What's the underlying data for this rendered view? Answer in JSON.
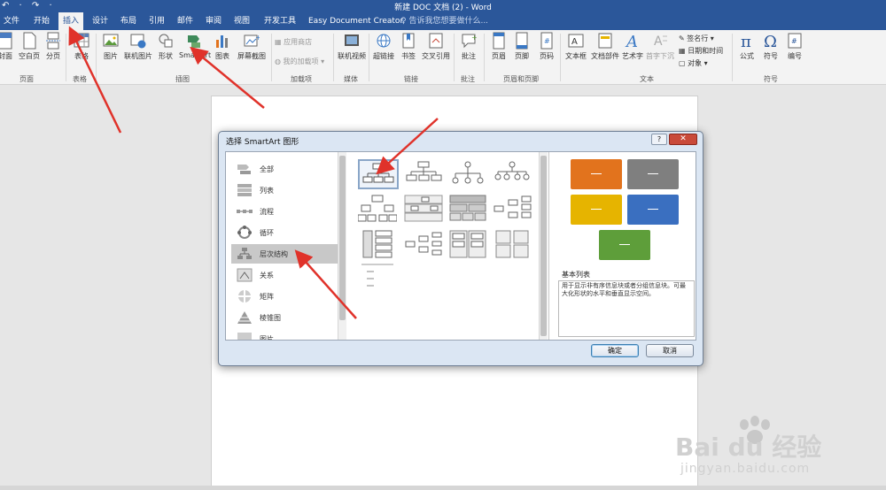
{
  "window": {
    "title": "新建 DOC 文档 (2) - Word",
    "quick_access": "↶ · ↷ ·"
  },
  "tabs": [
    {
      "label": "文件"
    },
    {
      "label": "开始"
    },
    {
      "label": "插入",
      "active": true
    },
    {
      "label": "设计"
    },
    {
      "label": "布局"
    },
    {
      "label": "引用"
    },
    {
      "label": "邮件"
    },
    {
      "label": "审阅"
    },
    {
      "label": "视图"
    },
    {
      "label": "开发工具"
    },
    {
      "label": "Easy Document Creator"
    }
  ],
  "tell_me": "♀ 告诉我您想要做什么...",
  "ribbon": {
    "buttons": {
      "cover": "封面",
      "blank_page": "空白页",
      "page_break": "分页",
      "table": "表格",
      "picture": "图片",
      "online_picture": "联机图片",
      "shapes": "形状",
      "smartart": "SmartArt",
      "chart": "图表",
      "screenshot": "屏幕截图",
      "store": "应用商店",
      "my_addins": "我的加载项",
      "online_video": "联机视频",
      "hyperlink": "超链接",
      "bookmark": "书签",
      "cross_reference": "交叉引用",
      "comment": "批注",
      "header": "页眉",
      "footer": "页脚",
      "page_number": "页码",
      "text_box": "文本框",
      "quick_parts": "文档部件",
      "wordart": "艺术字",
      "drop_cap": "首字下沉",
      "signature_line": "签名行",
      "date_time": "日期和时间",
      "object": "对象",
      "equation": "公式",
      "symbol": "符号",
      "numbering": "编号"
    },
    "groups": {
      "pages": "页面",
      "tables": "表格",
      "illustrations": "插图",
      "addins": "加载项",
      "media": "媒体",
      "links": "链接",
      "comments": "批注",
      "header_footer": "页眉和页脚",
      "text": "文本",
      "symbols": "符号"
    }
  },
  "dialog": {
    "title": "选择 SmartArt 图形",
    "help": "?",
    "close": "✕",
    "categories": [
      {
        "label": "全部",
        "icon": "all-icon"
      },
      {
        "label": "列表",
        "icon": "list-icon"
      },
      {
        "label": "流程",
        "icon": "process-icon"
      },
      {
        "label": "循环",
        "icon": "cycle-icon"
      },
      {
        "label": "层次结构",
        "icon": "hierarchy-icon",
        "selected": true
      },
      {
        "label": "关系",
        "icon": "relationship-icon"
      },
      {
        "label": "矩阵",
        "icon": "matrix-icon"
      },
      {
        "label": "棱锥图",
        "icon": "pyramid-icon"
      },
      {
        "label": "图片",
        "icon": "picture-icon"
      }
    ],
    "preview": {
      "title": "基本列表",
      "description": "用于显示非有序信息块或者分组信息块。可最大化形状的水平和垂直显示空间。",
      "colors": [
        "#e2731d",
        "#7f7f7f",
        "#e6b400",
        "#3a6fc0",
        "#5e9e3a"
      ]
    },
    "ok": "确定",
    "cancel": "取消"
  },
  "watermark": {
    "brand": "Bai du 经验",
    "url": "jingyan.baidu.com"
  }
}
